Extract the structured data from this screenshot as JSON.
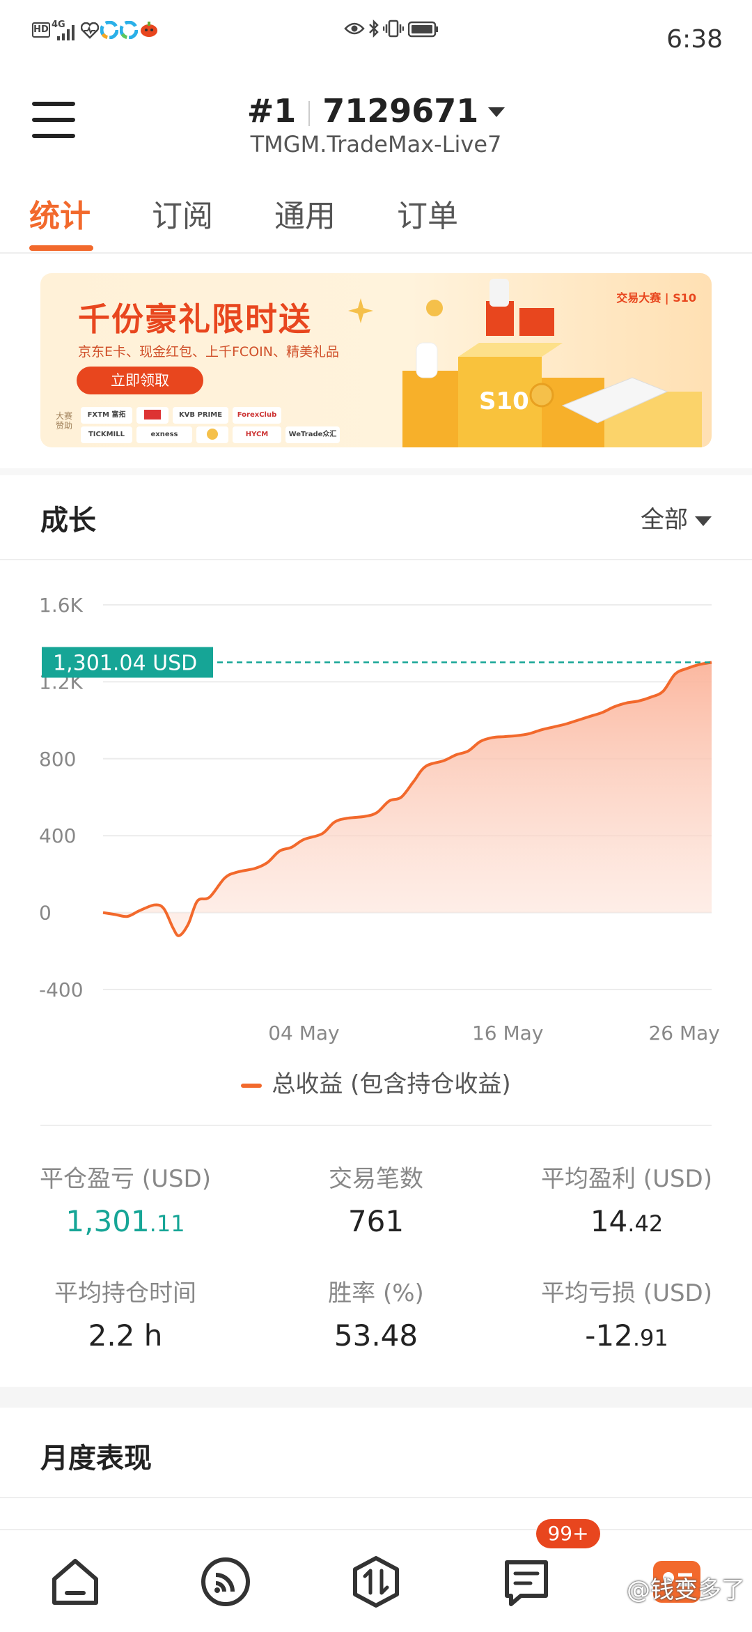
{
  "status_bar": {
    "time": "6:38",
    "network_label": "HD",
    "signal_label": "4G",
    "icons": [
      "hd-icon",
      "signal-icon",
      "health-icon",
      "app-icon",
      "app-icon",
      "pumpkin-icon",
      "eye-icon",
      "bluetooth-icon",
      "vibrate-icon",
      "battery-icon"
    ]
  },
  "header": {
    "account_rank": "#1",
    "account_number": "7129671",
    "server": "TMGM.TradeMax-Live7"
  },
  "tabs": [
    {
      "label": "统计",
      "active": true
    },
    {
      "label": "订阅",
      "active": false
    },
    {
      "label": "通用",
      "active": false
    },
    {
      "label": "订单",
      "active": false
    }
  ],
  "banner": {
    "title": "千份豪礼限时送",
    "subtitle": "京东E卡、现金红包、上千FCOIN、精美礼品",
    "button": "立即领取",
    "sponsor_label": "大赛赞助",
    "brand": "交易大赛 | S10",
    "sponsors": [
      "FXTM 富拓",
      "",
      "KVB PRIME",
      "ForexClub",
      "TICKMILL",
      "exness",
      "",
      "HYCM",
      "WeTrade众汇"
    ]
  },
  "growth": {
    "title": "成长",
    "filter": "全部",
    "legend": "总收益 (包含持仓收益)"
  },
  "chart_data": {
    "type": "area",
    "title": "",
    "xlabel": "",
    "ylabel": "",
    "ylim": [
      -400,
      1600
    ],
    "y_ticks": [
      "1.6K",
      "1.2K",
      "800",
      "400",
      "0",
      "-400"
    ],
    "x_ticks": [
      "04 May",
      "16 May",
      "26 May"
    ],
    "current_value_label": "1,301.04 USD",
    "current_value": 1301.04,
    "series": [
      {
        "name": "总收益 (包含持仓收益)",
        "points": [
          [
            0,
            0
          ],
          [
            0.02,
            -10
          ],
          [
            0.04,
            -20
          ],
          [
            0.06,
            10
          ],
          [
            0.085,
            40
          ],
          [
            0.1,
            20
          ],
          [
            0.115,
            -80
          ],
          [
            0.125,
            -120
          ],
          [
            0.14,
            -60
          ],
          [
            0.155,
            60
          ],
          [
            0.175,
            80
          ],
          [
            0.2,
            180
          ],
          [
            0.22,
            210
          ],
          [
            0.25,
            230
          ],
          [
            0.27,
            260
          ],
          [
            0.29,
            320
          ],
          [
            0.31,
            340
          ],
          [
            0.33,
            380
          ],
          [
            0.36,
            410
          ],
          [
            0.38,
            470
          ],
          [
            0.4,
            490
          ],
          [
            0.43,
            500
          ],
          [
            0.45,
            520
          ],
          [
            0.47,
            580
          ],
          [
            0.49,
            600
          ],
          [
            0.51,
            680
          ],
          [
            0.53,
            760
          ],
          [
            0.56,
            790
          ],
          [
            0.58,
            820
          ],
          [
            0.6,
            840
          ],
          [
            0.62,
            890
          ],
          [
            0.64,
            910
          ],
          [
            0.66,
            915
          ],
          [
            0.68,
            920
          ],
          [
            0.7,
            930
          ],
          [
            0.72,
            950
          ],
          [
            0.74,
            965
          ],
          [
            0.76,
            980
          ],
          [
            0.78,
            1000
          ],
          [
            0.8,
            1020
          ],
          [
            0.82,
            1040
          ],
          [
            0.84,
            1070
          ],
          [
            0.86,
            1090
          ],
          [
            0.88,
            1100
          ],
          [
            0.9,
            1120
          ],
          [
            0.92,
            1150
          ],
          [
            0.94,
            1240
          ],
          [
            0.96,
            1270
          ],
          [
            0.98,
            1290
          ],
          [
            1.0,
            1301
          ]
        ]
      }
    ],
    "colors": {
      "line": "#f2692c",
      "fill": "#fbb49b",
      "marker": "#16a596"
    }
  },
  "stats": [
    {
      "label": "平仓盈亏 (USD)",
      "int": "1,301",
      "dec": ".11",
      "green": true
    },
    {
      "label": "交易笔数",
      "int": "761",
      "dec": "",
      "green": false
    },
    {
      "label": "平均盈利 (USD)",
      "int": "14",
      "dec": ".42",
      "green": false
    },
    {
      "label": "平均持仓时间",
      "int": "2.2 h",
      "dec": "",
      "green": false
    },
    {
      "label": "胜率 (%)",
      "int": "53.48",
      "dec": "",
      "green": false
    },
    {
      "label": "平均亏损 (USD)",
      "int": "-12",
      "dec": ".91",
      "green": false
    }
  ],
  "monthly": {
    "title": "月度表现"
  },
  "bottom_nav": {
    "badge": "99+",
    "watermark": "@钱变多了",
    "items": [
      "home-icon",
      "feed-icon",
      "trade-icon",
      "messages-icon",
      "profile-icon"
    ]
  },
  "accent_color": "#f2692c"
}
